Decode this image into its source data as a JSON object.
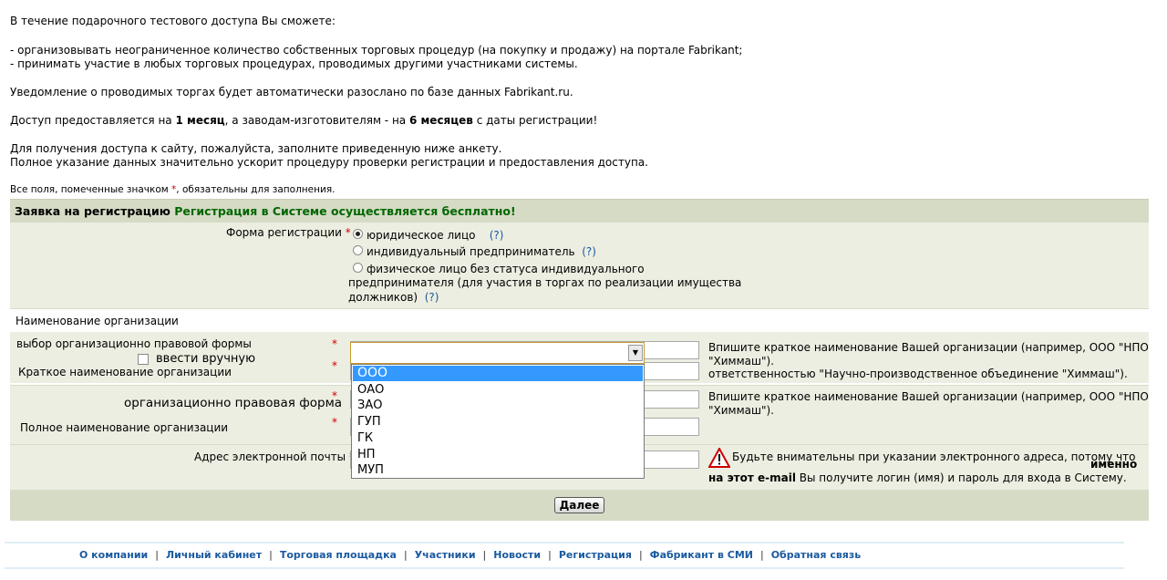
{
  "intro": {
    "line1": "В течение подарочного тестового доступа Вы сможете:",
    "bullet1": "- организовывать неограниченное количество собственных торговых процедур (на покупку и продажу) на портале Fabrikant;",
    "bullet2": "- принимать участие в любых торговых процедурах, проводимых другими участниками системы.",
    "notice": "Уведомление о проводимых торгах будет автоматически разослано по базе данных Fabrikant.ru.",
    "access_a": "Доступ предоставляется на ",
    "access_b": "1 месяц",
    "access_c": ", а заводам-изготовителям - на ",
    "access_d": "6 месяцев",
    "access_e": " с даты регистрации!",
    "fill1": "Для получения доступа к сайту, пожалуйста, заполните приведенную ниже анкету.",
    "fill2": "Полное указание данных значительно ускорит процедуру проверки регистрации и предоставления доступа.",
    "req_a": "Все поля, помеченные значком ",
    "req_star": "*",
    "req_b": ", обязательны для заполнения."
  },
  "form": {
    "header_a": "Заявка на регистрацию ",
    "header_b": "Регистрация в Системе осуществляется бесплатно!",
    "reg_form_label": "Форма регистрации",
    "star": "*",
    "radio_options": [
      "юридическое лицо",
      "индивидуальный предприниматель",
      "физическое лицо без статуса индивидуального",
      "предпринимателя (для участия в торгах по реализации имущества",
      "должников)"
    ],
    "help": "(?)",
    "org_section": "Наименование организации",
    "org_type_label": "выбор организационно правовой формы",
    "manual_label": "ввести вручную",
    "short_name_label": "Краткое наименование организации",
    "legal_form_label": "организационно правовая форма",
    "full_name_label": "Полное наименование организации",
    "email_label": "Адрес электронной почты",
    "hint_short_1": "Впишите краткое наименование Вашей организации (например, ООО \"НПО",
    "hint_short_2": "\"Химмаш\").",
    "hint_short_3": "ответственностью \"Научно-производственное объединение \"Химмаш\").",
    "hint_full_1": "Впишите краткое наименование Вашей организации (например, ООО \"НПО",
    "hint_full_2": "\"Химмаш\").",
    "hint_email_1": "Будьте внимательны при указании электронного адреса, потому что ",
    "hint_email_b1": "именно",
    "hint_email_b2": "на этот e-mail",
    "hint_email_2": " Вы получите логин (имя) и пароль для входа в Систему.",
    "dropdown_options": [
      "ООО",
      "ОАО",
      "ЗАО",
      "ГУП",
      "ГК",
      "НП",
      "МУП"
    ],
    "next_button": "Далее"
  },
  "footer": {
    "links": [
      "О компании",
      "Личный кабинет",
      "Торговая площадка",
      "Участники",
      "Новости",
      "Регистрация",
      "Фабрикант в СМИ",
      "Обратная связь"
    ]
  }
}
